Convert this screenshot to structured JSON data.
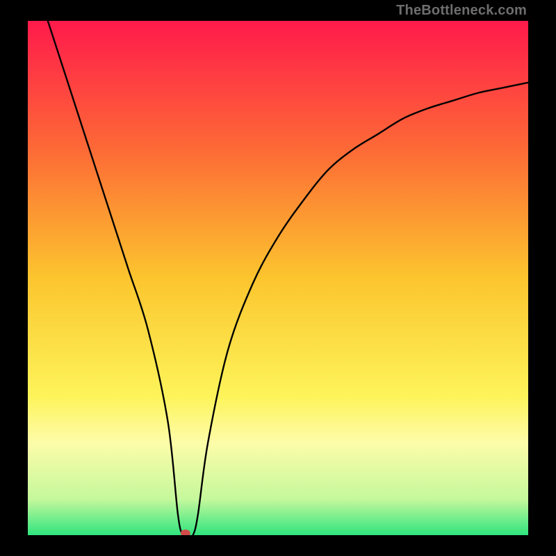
{
  "watermark": "TheBottleneck.com",
  "chart_data": {
    "type": "line",
    "title": "",
    "xlabel": "",
    "ylabel": "",
    "xlim": [
      0,
      100
    ],
    "ylim": [
      0,
      100
    ],
    "grid": false,
    "legend": false,
    "gradient_stops": [
      {
        "offset": 0.0,
        "color": "#ff1a4b"
      },
      {
        "offset": 0.25,
        "color": "#fd6a36"
      },
      {
        "offset": 0.5,
        "color": "#fcc52e"
      },
      {
        "offset": 0.73,
        "color": "#fdf45a"
      },
      {
        "offset": 0.82,
        "color": "#fdfca9"
      },
      {
        "offset": 0.93,
        "color": "#c5f89c"
      },
      {
        "offset": 1.0,
        "color": "#2fe57f"
      }
    ],
    "series": [
      {
        "name": "bottleneck-curve",
        "x": [
          4,
          8,
          12,
          16,
          20,
          24,
          28,
          30,
          31,
          32,
          33,
          34,
          36,
          40,
          45,
          50,
          55,
          60,
          65,
          70,
          75,
          80,
          85,
          90,
          95,
          100
        ],
        "values": [
          100,
          88,
          76,
          64,
          52,
          40,
          22,
          4,
          0,
          0,
          0,
          4,
          18,
          36,
          49,
          58,
          65,
          71,
          75,
          78,
          81,
          83,
          84.5,
          86,
          87,
          88
        ]
      }
    ],
    "marker": {
      "name": "minimum-point",
      "x": 31.5,
      "y": 0,
      "color": "#d24a4a",
      "rx": 7,
      "ry": 5
    }
  }
}
